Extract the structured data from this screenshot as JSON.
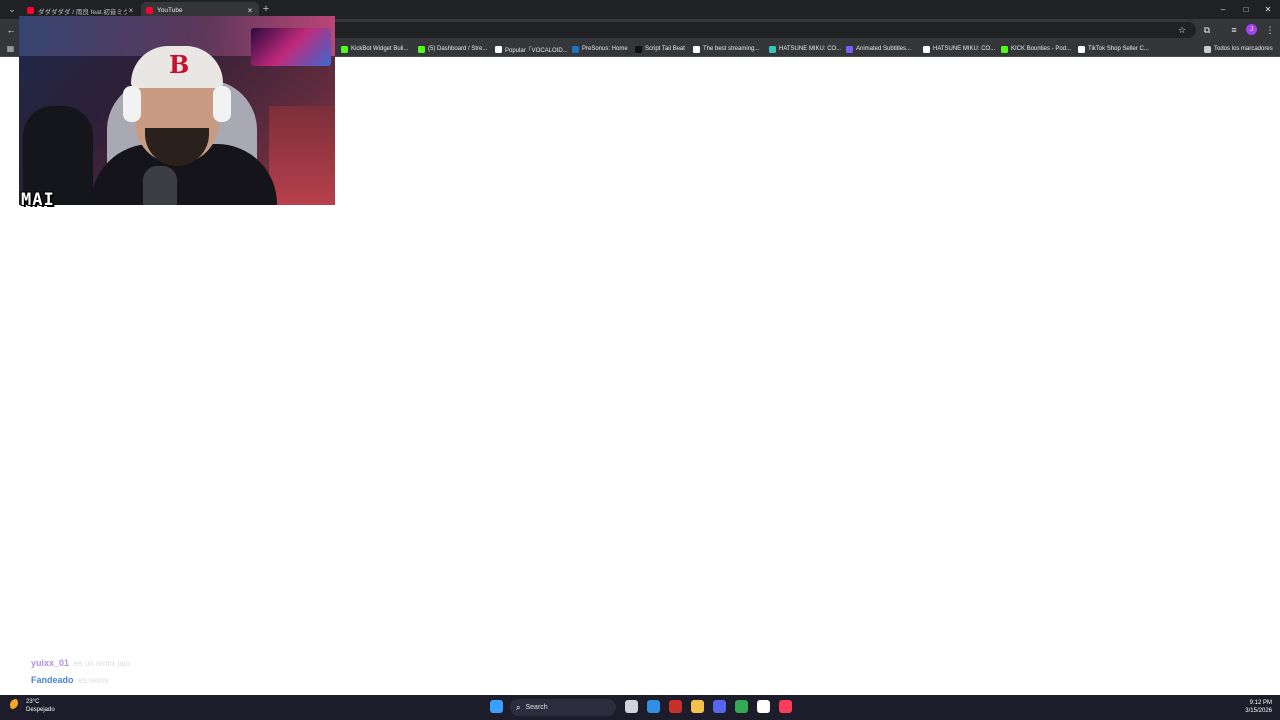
{
  "browser": {
    "tabs": [
      {
        "title": "ダダダダダ / 雨良 feat.初音ミク(V...",
        "close": "×",
        "active": false
      },
      {
        "title": "YouTube",
        "close": "×",
        "active": true
      }
    ],
    "new_tab": "+",
    "tab_list": "⌄",
    "window_controls": {
      "minimize": "–",
      "maximize": "□",
      "close": "✕"
    },
    "profile_initial": "J",
    "bookmarks": [
      {
        "label": "KickBot Widget Buil...",
        "color": "#53fc18"
      },
      {
        "label": "(5) Dashboard / Stre...",
        "color": "#53fc18"
      },
      {
        "label": "Popular「VOCALOID...",
        "color": "#ffffff"
      },
      {
        "label": "PreSonus: Home",
        "color": "#1e73be"
      },
      {
        "label": "Script Tail Beat",
        "color": "#111111"
      },
      {
        "label": "The best streaming...",
        "color": "#ffffff"
      },
      {
        "label": "HATSUNE MIKU: CO...",
        "color": "#39c5bb"
      },
      {
        "label": "Animated Subtitles...",
        "color": "#7b5cff"
      },
      {
        "label": "HATSUNE MIKU: CO...",
        "color": "#ffffff"
      },
      {
        "label": "KICK Bounties - Pod...",
        "color": "#53fc18"
      },
      {
        "label": "TikTok Shop Seller C...",
        "color": "#ffffff"
      }
    ],
    "all_bookmarks": "Todos los marcadores"
  },
  "webcam": {
    "name_tag": "MAI",
    "cap_letter": "B"
  },
  "chat": [
    {
      "user": "yuixx_01",
      "color": "#b98de0",
      "message": "es un remix jajo"
    },
    {
      "user": "Fandeado",
      "color": "#4a84d6",
      "message": "es remix"
    }
  ],
  "taskbar": {
    "weather_temp": "23°C",
    "weather_condition": "Despejado",
    "search_label": "Search",
    "time": "9:12 PM",
    "date": "3/15/2026",
    "apps": [
      {
        "icon": "windows-start-icon",
        "color": "#3aa0ff"
      },
      {
        "icon": "task-view-icon",
        "color": "#cfd3dc"
      },
      {
        "icon": "edge-icon",
        "color": "#2f8fe0"
      },
      {
        "icon": "steam-icon",
        "color": "#c9302c"
      },
      {
        "icon": "file-explorer-icon",
        "color": "#f2c14e"
      },
      {
        "icon": "discord-icon",
        "color": "#5865f2"
      },
      {
        "icon": "chrome-icon",
        "color": "#34a853"
      },
      {
        "icon": "chatgpt-icon",
        "color": "#ffffff"
      },
      {
        "icon": "itunes-icon",
        "color": "#fc3c5a"
      }
    ]
  }
}
